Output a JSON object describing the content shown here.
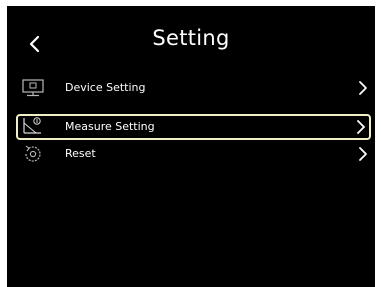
{
  "header": {
    "title": "Setting",
    "back_icon": "chevron-left-icon"
  },
  "menu": {
    "items": [
      {
        "label": "Device Setting",
        "icon": "monitor-icon",
        "selected": false
      },
      {
        "label": "Measure Setting",
        "icon": "measure-icon",
        "selected": true
      },
      {
        "label": "Reset",
        "icon": "reset-icon",
        "selected": false
      }
    ],
    "chevron_icon": "chevron-right-icon"
  },
  "colors": {
    "background": "#000000",
    "text": "#ffffff",
    "selection_border": "#f1efc6",
    "icon_gray": "#b9b9b9"
  }
}
